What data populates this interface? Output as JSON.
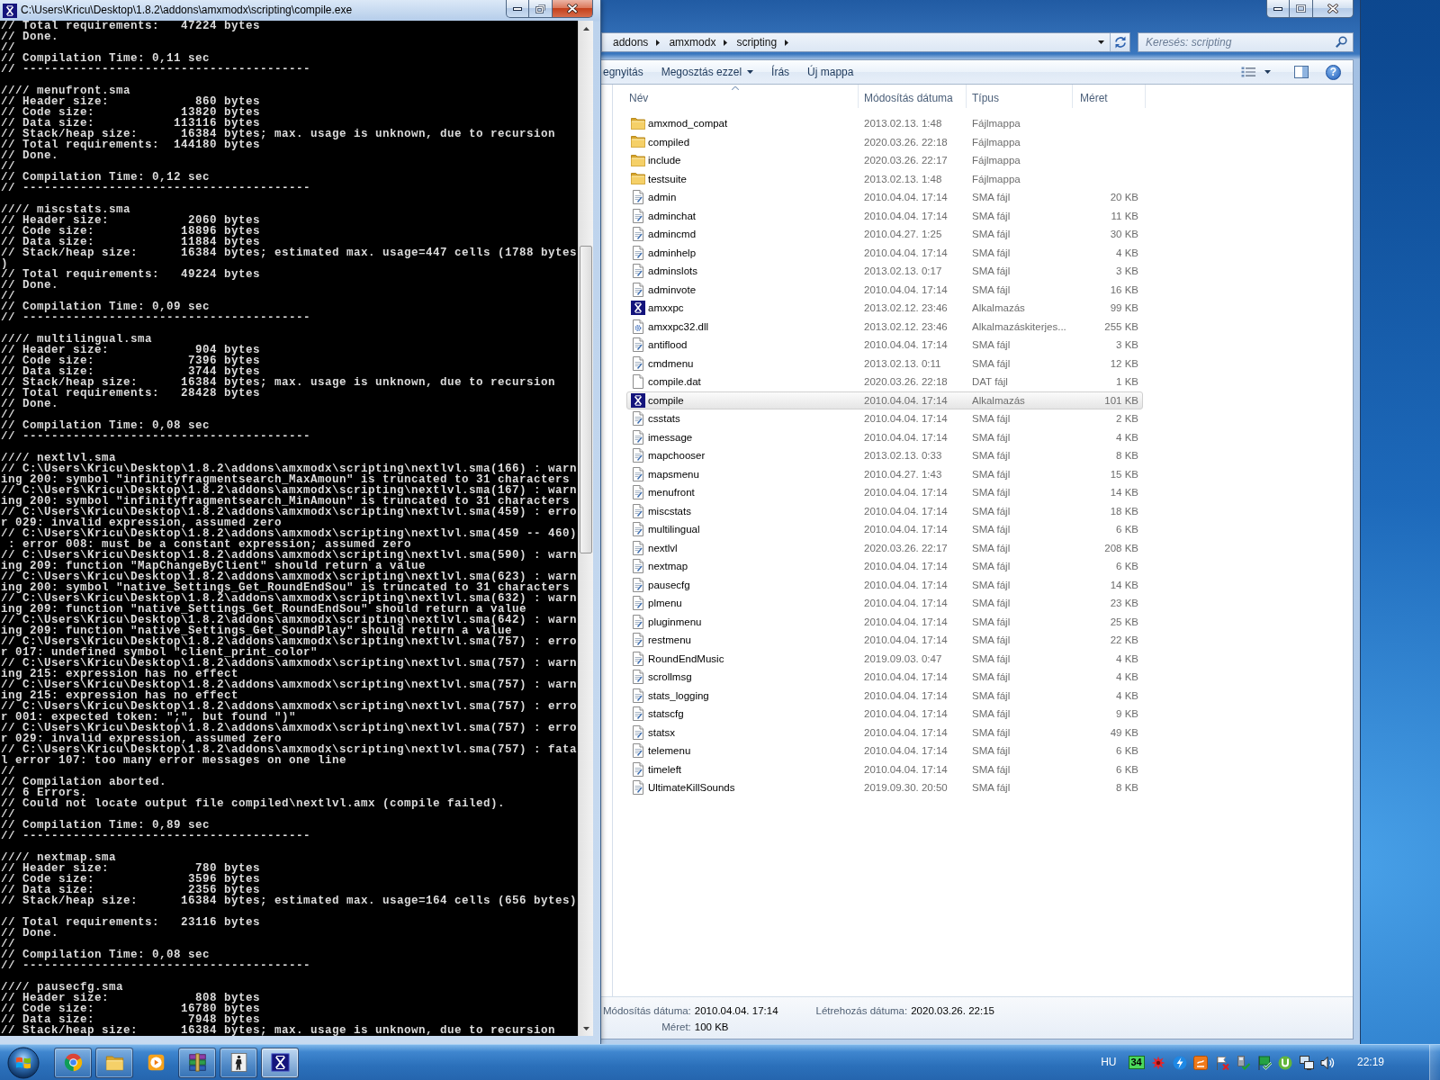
{
  "console": {
    "title": "C:\\Users\\Kricu\\Desktop\\1.8.2\\addons\\amxmodx\\scripting\\compile.exe",
    "active": true,
    "maximized": true,
    "paragraphs": [
      [
        "// Total requirements:   47224 bytes",
        "// Done.",
        "//",
        "// Compilation Time: 0,11 sec",
        "// ----------------------------------------"
      ],
      [
        "//// menufront.sma",
        "// Header size:            860 bytes",
        "// Code size:            13820 bytes",
        "// Data size:           113116 bytes",
        "// Stack/heap size:      16384 bytes; max. usage is unknown, due to recursion",
        "// Total requirements:  144180 bytes",
        "// Done.",
        "//",
        "// Compilation Time: 0,12 sec",
        "// ----------------------------------------"
      ],
      [
        "//// miscstats.sma",
        "// Header size:           2060 bytes",
        "// Code size:            18896 bytes",
        "// Data size:            11884 bytes",
        "// Stack/heap size:      16384 bytes; estimated max. usage=447 cells (1788 bytes",
        ")",
        "// Total requirements:   49224 bytes",
        "// Done.",
        "//",
        "// Compilation Time: 0,09 sec",
        "// ----------------------------------------"
      ],
      [
        "//// multilingual.sma",
        "// Header size:            904 bytes",
        "// Code size:             7396 bytes",
        "// Data size:             3744 bytes",
        "// Stack/heap size:      16384 bytes; max. usage is unknown, due to recursion",
        "// Total requirements:   28428 bytes",
        "// Done.",
        "//",
        "// Compilation Time: 0,08 sec",
        "// ----------------------------------------"
      ],
      [
        "//// nextlvl.sma",
        "// C:\\Users\\Kricu\\Desktop\\1.8.2\\addons\\amxmodx\\scripting\\nextlvl.sma(166) : warn",
        "ing 200: symbol \"infinityfragmentsearch_MaxAmoun\" is truncated to 31 characters",
        "// C:\\Users\\Kricu\\Desktop\\1.8.2\\addons\\amxmodx\\scripting\\nextlvl.sma(167) : warn",
        "ing 200: symbol \"infinityfragmentsearch_MinAmoun\" is truncated to 31 characters",
        "// C:\\Users\\Kricu\\Desktop\\1.8.2\\addons\\amxmodx\\scripting\\nextlvl.sma(459) : erro",
        "r 029: invalid expression, assumed zero",
        "// C:\\Users\\Kricu\\Desktop\\1.8.2\\addons\\amxmodx\\scripting\\nextlvl.sma(459 -- 460)",
        " : error 008: must be a constant expression; assumed zero",
        "// C:\\Users\\Kricu\\Desktop\\1.8.2\\addons\\amxmodx\\scripting\\nextlvl.sma(590) : warn",
        "ing 209: function \"MapChangeByClient\" should return a value",
        "// C:\\Users\\Kricu\\Desktop\\1.8.2\\addons\\amxmodx\\scripting\\nextlvl.sma(623) : warn",
        "ing 200: symbol \"native_Settings_Get_RoundEndSou\" is truncated to 31 characters",
        "// C:\\Users\\Kricu\\Desktop\\1.8.2\\addons\\amxmodx\\scripting\\nextlvl.sma(632) : warn",
        "ing 209: function \"native_Settings_Get_RoundEndSou\" should return a value",
        "// C:\\Users\\Kricu\\Desktop\\1.8.2\\addons\\amxmodx\\scripting\\nextlvl.sma(642) : warn",
        "ing 209: function \"native_Settings_Get_SoundPlay\" should return a value",
        "// C:\\Users\\Kricu\\Desktop\\1.8.2\\addons\\amxmodx\\scripting\\nextlvl.sma(757) : erro",
        "r 017: undefined symbol \"client_print_color\"",
        "// C:\\Users\\Kricu\\Desktop\\1.8.2\\addons\\amxmodx\\scripting\\nextlvl.sma(757) : warn",
        "ing 215: expression has no effect",
        "// C:\\Users\\Kricu\\Desktop\\1.8.2\\addons\\amxmodx\\scripting\\nextlvl.sma(757) : warn",
        "ing 215: expression has no effect",
        "// C:\\Users\\Kricu\\Desktop\\1.8.2\\addons\\amxmodx\\scripting\\nextlvl.sma(757) : erro",
        "r 001: expected token: \";\", but found \")\"",
        "// C:\\Users\\Kricu\\Desktop\\1.8.2\\addons\\amxmodx\\scripting\\nextlvl.sma(757) : erro",
        "r 029: invalid expression, assumed zero",
        "// C:\\Users\\Kricu\\Desktop\\1.8.2\\addons\\amxmodx\\scripting\\nextlvl.sma(757) : fata",
        "l error 107: too many error messages on one line",
        "//",
        "// Compilation aborted.",
        "// 6 Errors.",
        "// Could not locate output file compiled\\nextlvl.amx (compile failed).",
        "//",
        "// Compilation Time: 0,89 sec",
        "// ----------------------------------------"
      ],
      [
        "//// nextmap.sma",
        "// Header size:            780 bytes",
        "// Code size:             3596 bytes",
        "// Data size:             2356 bytes",
        "// Stack/heap size:      16384 bytes; estimated max. usage=164 cells (656 bytes)"
      ],
      [
        "// Total requirements:   23116 bytes",
        "// Done.",
        "//",
        "// Compilation Time: 0,08 sec",
        "// ----------------------------------------"
      ],
      [
        "//// pausecfg.sma",
        "// Header size:            808 bytes",
        "// Code size:            16780 bytes",
        "// Data size:             7948 bytes",
        "// Stack/heap size:      16384 bytes; max. usage is unknown, due to recursion"
      ]
    ]
  },
  "explorer": {
    "active": false,
    "maximized": false,
    "breadcrumb": [
      "addons",
      "amxmodx",
      "scripting"
    ],
    "search": {
      "placeholder": "Keresés: scripting"
    },
    "toolbar": [
      {
        "label": "egnyitás",
        "kind": "plain"
      },
      {
        "label": "Megosztás ezzel",
        "kind": "menu"
      },
      {
        "label": "Írás",
        "kind": "plain"
      },
      {
        "label": "Új mappa",
        "kind": "plain"
      }
    ],
    "help": "?",
    "columns": [
      {
        "label": "Név",
        "sorted": true
      },
      {
        "label": "Módosítás dátuma",
        "sorted": false
      },
      {
        "label": "Típus",
        "sorted": false
      },
      {
        "label": "Méret",
        "sorted": false
      }
    ],
    "files": [
      {
        "name": "amxmod_compat",
        "modified": "2013.02.13. 1:48",
        "type": "Fájlmappa",
        "kind": "folder",
        "selected": false
      },
      {
        "name": "compiled",
        "modified": "2020.03.26. 22:18",
        "type": "Fájlmappa",
        "kind": "folder",
        "selected": false
      },
      {
        "name": "include",
        "modified": "2020.03.26. 22:17",
        "type": "Fájlmappa",
        "kind": "folder",
        "selected": false
      },
      {
        "name": "testsuite",
        "modified": "2013.02.13. 1:48",
        "type": "Fájlmappa",
        "kind": "folder",
        "selected": false
      },
      {
        "name": "admin",
        "modified": "2010.04.04. 17:14",
        "type": "SMA fájl",
        "size": "20 KB",
        "kind": "sma",
        "selected": false
      },
      {
        "name": "adminchat",
        "modified": "2010.04.04. 17:14",
        "type": "SMA fájl",
        "size": "11 KB",
        "kind": "sma",
        "selected": false
      },
      {
        "name": "admincmd",
        "modified": "2010.04.27. 1:25",
        "type": "SMA fájl",
        "size": "30 KB",
        "kind": "sma",
        "selected": false
      },
      {
        "name": "adminhelp",
        "modified": "2010.04.04. 17:14",
        "type": "SMA fájl",
        "size": "4 KB",
        "kind": "sma",
        "selected": false
      },
      {
        "name": "adminslots",
        "modified": "2013.02.13. 0:17",
        "type": "SMA fájl",
        "size": "3 KB",
        "kind": "sma",
        "selected": false
      },
      {
        "name": "adminvote",
        "modified": "2010.04.04. 17:14",
        "type": "SMA fájl",
        "size": "16 KB",
        "kind": "sma",
        "selected": false
      },
      {
        "name": "amxxpc",
        "modified": "2013.02.12. 23:46",
        "type": "Alkalmazás",
        "size": "99 KB",
        "kind": "app",
        "selected": false
      },
      {
        "name": "amxxpc32.dll",
        "modified": "2013.02.12. 23:46",
        "type": "Alkalmazáskiterjes...",
        "size": "255 KB",
        "kind": "dll",
        "selected": false
      },
      {
        "name": "antiflood",
        "modified": "2010.04.04. 17:14",
        "type": "SMA fájl",
        "size": "3 KB",
        "kind": "sma",
        "selected": false
      },
      {
        "name": "cmdmenu",
        "modified": "2013.02.13. 0:11",
        "type": "SMA fájl",
        "size": "12 KB",
        "kind": "sma",
        "selected": false
      },
      {
        "name": "compile.dat",
        "modified": "2020.03.26. 22:18",
        "type": "DAT fájl",
        "size": "1 KB",
        "kind": "dat",
        "selected": false
      },
      {
        "name": "compile",
        "modified": "2010.04.04. 17:14",
        "type": "Alkalmazás",
        "size": "101 KB",
        "kind": "app",
        "selected": true
      },
      {
        "name": "csstats",
        "modified": "2010.04.04. 17:14",
        "type": "SMA fájl",
        "size": "2 KB",
        "kind": "sma",
        "selected": false
      },
      {
        "name": "imessage",
        "modified": "2010.04.04. 17:14",
        "type": "SMA fájl",
        "size": "4 KB",
        "kind": "sma",
        "selected": false
      },
      {
        "name": "mapchooser",
        "modified": "2013.02.13. 0:33",
        "type": "SMA fájl",
        "size": "8 KB",
        "kind": "sma",
        "selected": false
      },
      {
        "name": "mapsmenu",
        "modified": "2010.04.27. 1:43",
        "type": "SMA fájl",
        "size": "15 KB",
        "kind": "sma",
        "selected": false
      },
      {
        "name": "menufront",
        "modified": "2010.04.04. 17:14",
        "type": "SMA fájl",
        "size": "14 KB",
        "kind": "sma",
        "selected": false
      },
      {
        "name": "miscstats",
        "modified": "2010.04.04. 17:14",
        "type": "SMA fájl",
        "size": "18 KB",
        "kind": "sma",
        "selected": false
      },
      {
        "name": "multilingual",
        "modified": "2010.04.04. 17:14",
        "type": "SMA fájl",
        "size": "6 KB",
        "kind": "sma",
        "selected": false
      },
      {
        "name": "nextlvl",
        "modified": "2020.03.26. 22:17",
        "type": "SMA fájl",
        "size": "208 KB",
        "kind": "sma",
        "selected": false
      },
      {
        "name": "nextmap",
        "modified": "2010.04.04. 17:14",
        "type": "SMA fájl",
        "size": "6 KB",
        "kind": "sma",
        "selected": false
      },
      {
        "name": "pausecfg",
        "modified": "2010.04.04. 17:14",
        "type": "SMA fájl",
        "size": "14 KB",
        "kind": "sma",
        "selected": false
      },
      {
        "name": "plmenu",
        "modified": "2010.04.04. 17:14",
        "type": "SMA fájl",
        "size": "23 KB",
        "kind": "sma",
        "selected": false
      },
      {
        "name": "pluginmenu",
        "modified": "2010.04.04. 17:14",
        "type": "SMA fájl",
        "size": "25 KB",
        "kind": "sma",
        "selected": false
      },
      {
        "name": "restmenu",
        "modified": "2010.04.04. 17:14",
        "type": "SMA fájl",
        "size": "22 KB",
        "kind": "sma",
        "selected": false
      },
      {
        "name": "RoundEndMusic",
        "modified": "2019.09.03. 0:47",
        "type": "SMA fájl",
        "size": "4 KB",
        "kind": "sma",
        "selected": false
      },
      {
        "name": "scrollmsg",
        "modified": "2010.04.04. 17:14",
        "type": "SMA fájl",
        "size": "4 KB",
        "kind": "sma",
        "selected": false
      },
      {
        "name": "stats_logging",
        "modified": "2010.04.04. 17:14",
        "type": "SMA fájl",
        "size": "4 KB",
        "kind": "sma",
        "selected": false
      },
      {
        "name": "statscfg",
        "modified": "2010.04.04. 17:14",
        "type": "SMA fájl",
        "size": "9 KB",
        "kind": "sma",
        "selected": false
      },
      {
        "name": "statsx",
        "modified": "2010.04.04. 17:14",
        "type": "SMA fájl",
        "size": "49 KB",
        "kind": "sma",
        "selected": false
      },
      {
        "name": "telemenu",
        "modified": "2010.04.04. 17:14",
        "type": "SMA fájl",
        "size": "6 KB",
        "kind": "sma",
        "selected": false
      },
      {
        "name": "timeleft",
        "modified": "2010.04.04. 17:14",
        "type": "SMA fájl",
        "size": "6 KB",
        "kind": "sma",
        "selected": false
      },
      {
        "name": "UltimateKillSounds",
        "modified": "2019.09.30. 20:50",
        "type": "SMA fájl",
        "size": "8 KB",
        "kind": "sma",
        "selected": false
      }
    ],
    "details": [
      {
        "label": "Módosítás dátuma:",
        "value": "2010.04.04. 17:14"
      },
      {
        "label": "Létrehozás dátuma:",
        "value": "2020.03.26. 22:15"
      },
      {
        "label": "Méret:",
        "value": "100 KB"
      }
    ]
  },
  "taskbar": {
    "apps": [
      {
        "kind": "browser",
        "running": true,
        "active": false
      },
      {
        "kind": "folder",
        "running": true,
        "active": false
      },
      {
        "kind": "player",
        "running": false,
        "active": false
      },
      {
        "kind": "archive",
        "running": true,
        "active": false
      },
      {
        "kind": "figure",
        "running": true,
        "active": false
      },
      {
        "kind": "cross-tile",
        "running": true,
        "active": true
      }
    ],
    "language": "HU",
    "tray": [
      {
        "kind": "counter",
        "label": "34"
      },
      {
        "kind": "splat"
      },
      {
        "kind": "lightning"
      },
      {
        "kind": "tile"
      },
      {
        "kind": "flag-cross"
      },
      {
        "kind": "device-check"
      },
      {
        "kind": "flag-check"
      },
      {
        "kind": "u-circle"
      },
      {
        "kind": "network"
      },
      {
        "kind": "speaker"
      }
    ],
    "clock": "22:19"
  }
}
